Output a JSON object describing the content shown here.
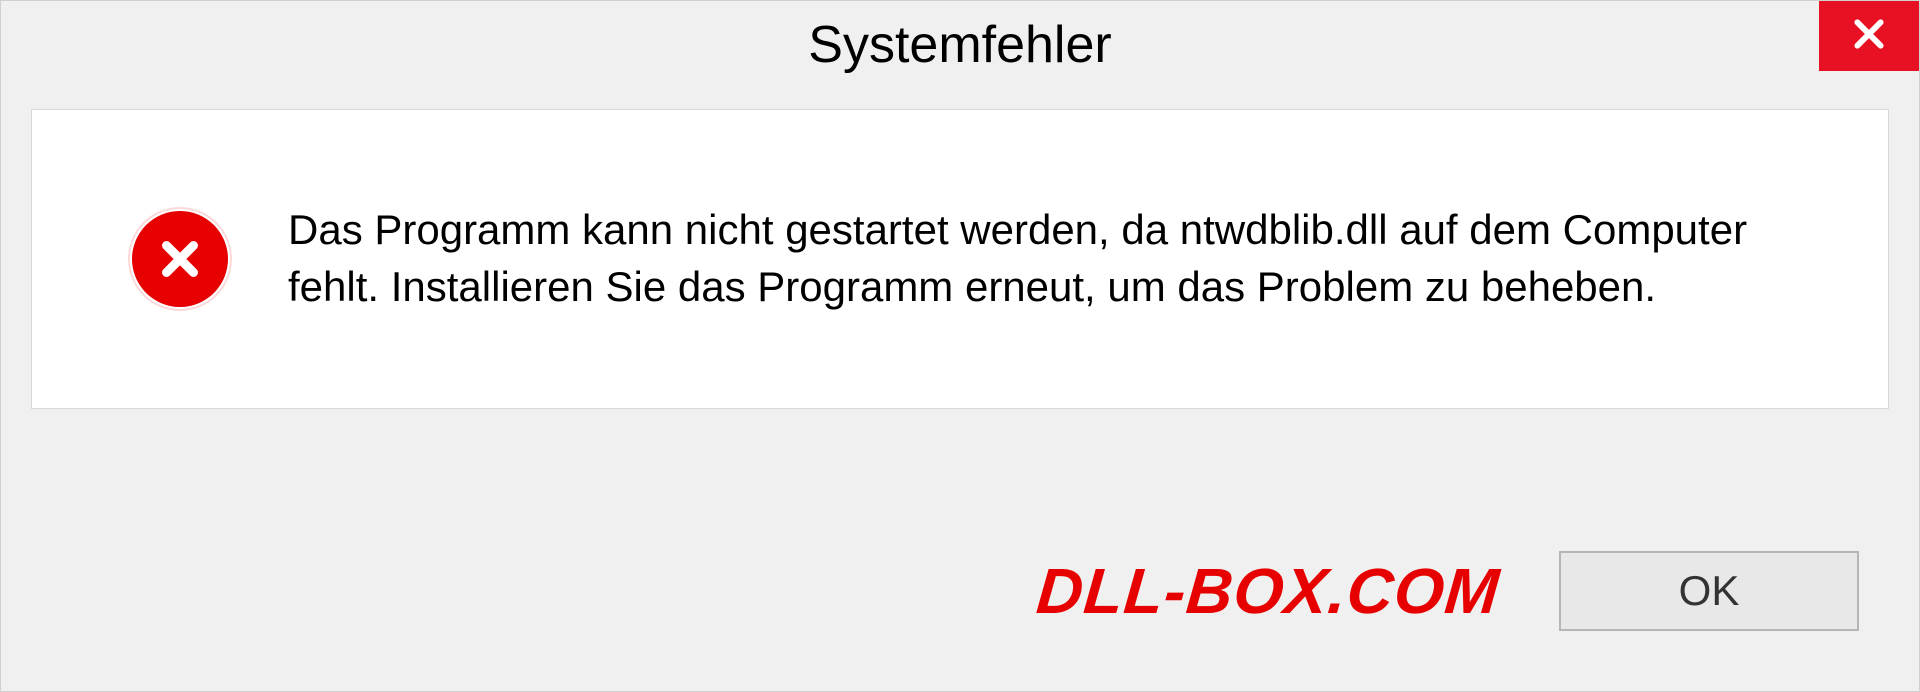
{
  "dialog": {
    "title": "Systemfehler",
    "message": "Das Programm kann nicht gestartet werden, da ntwdblib.dll auf dem Computer fehlt. Installieren Sie das Programm erneut, um das Problem zu beheben.",
    "ok_label": "OK"
  },
  "watermark": "DLL-BOX.COM",
  "icons": {
    "close": "close-icon",
    "error": "error-icon"
  },
  "colors": {
    "close_bg": "#e81123",
    "error_red": "#e60000",
    "dialog_bg": "#f0f0f0",
    "content_bg": "#ffffff"
  }
}
